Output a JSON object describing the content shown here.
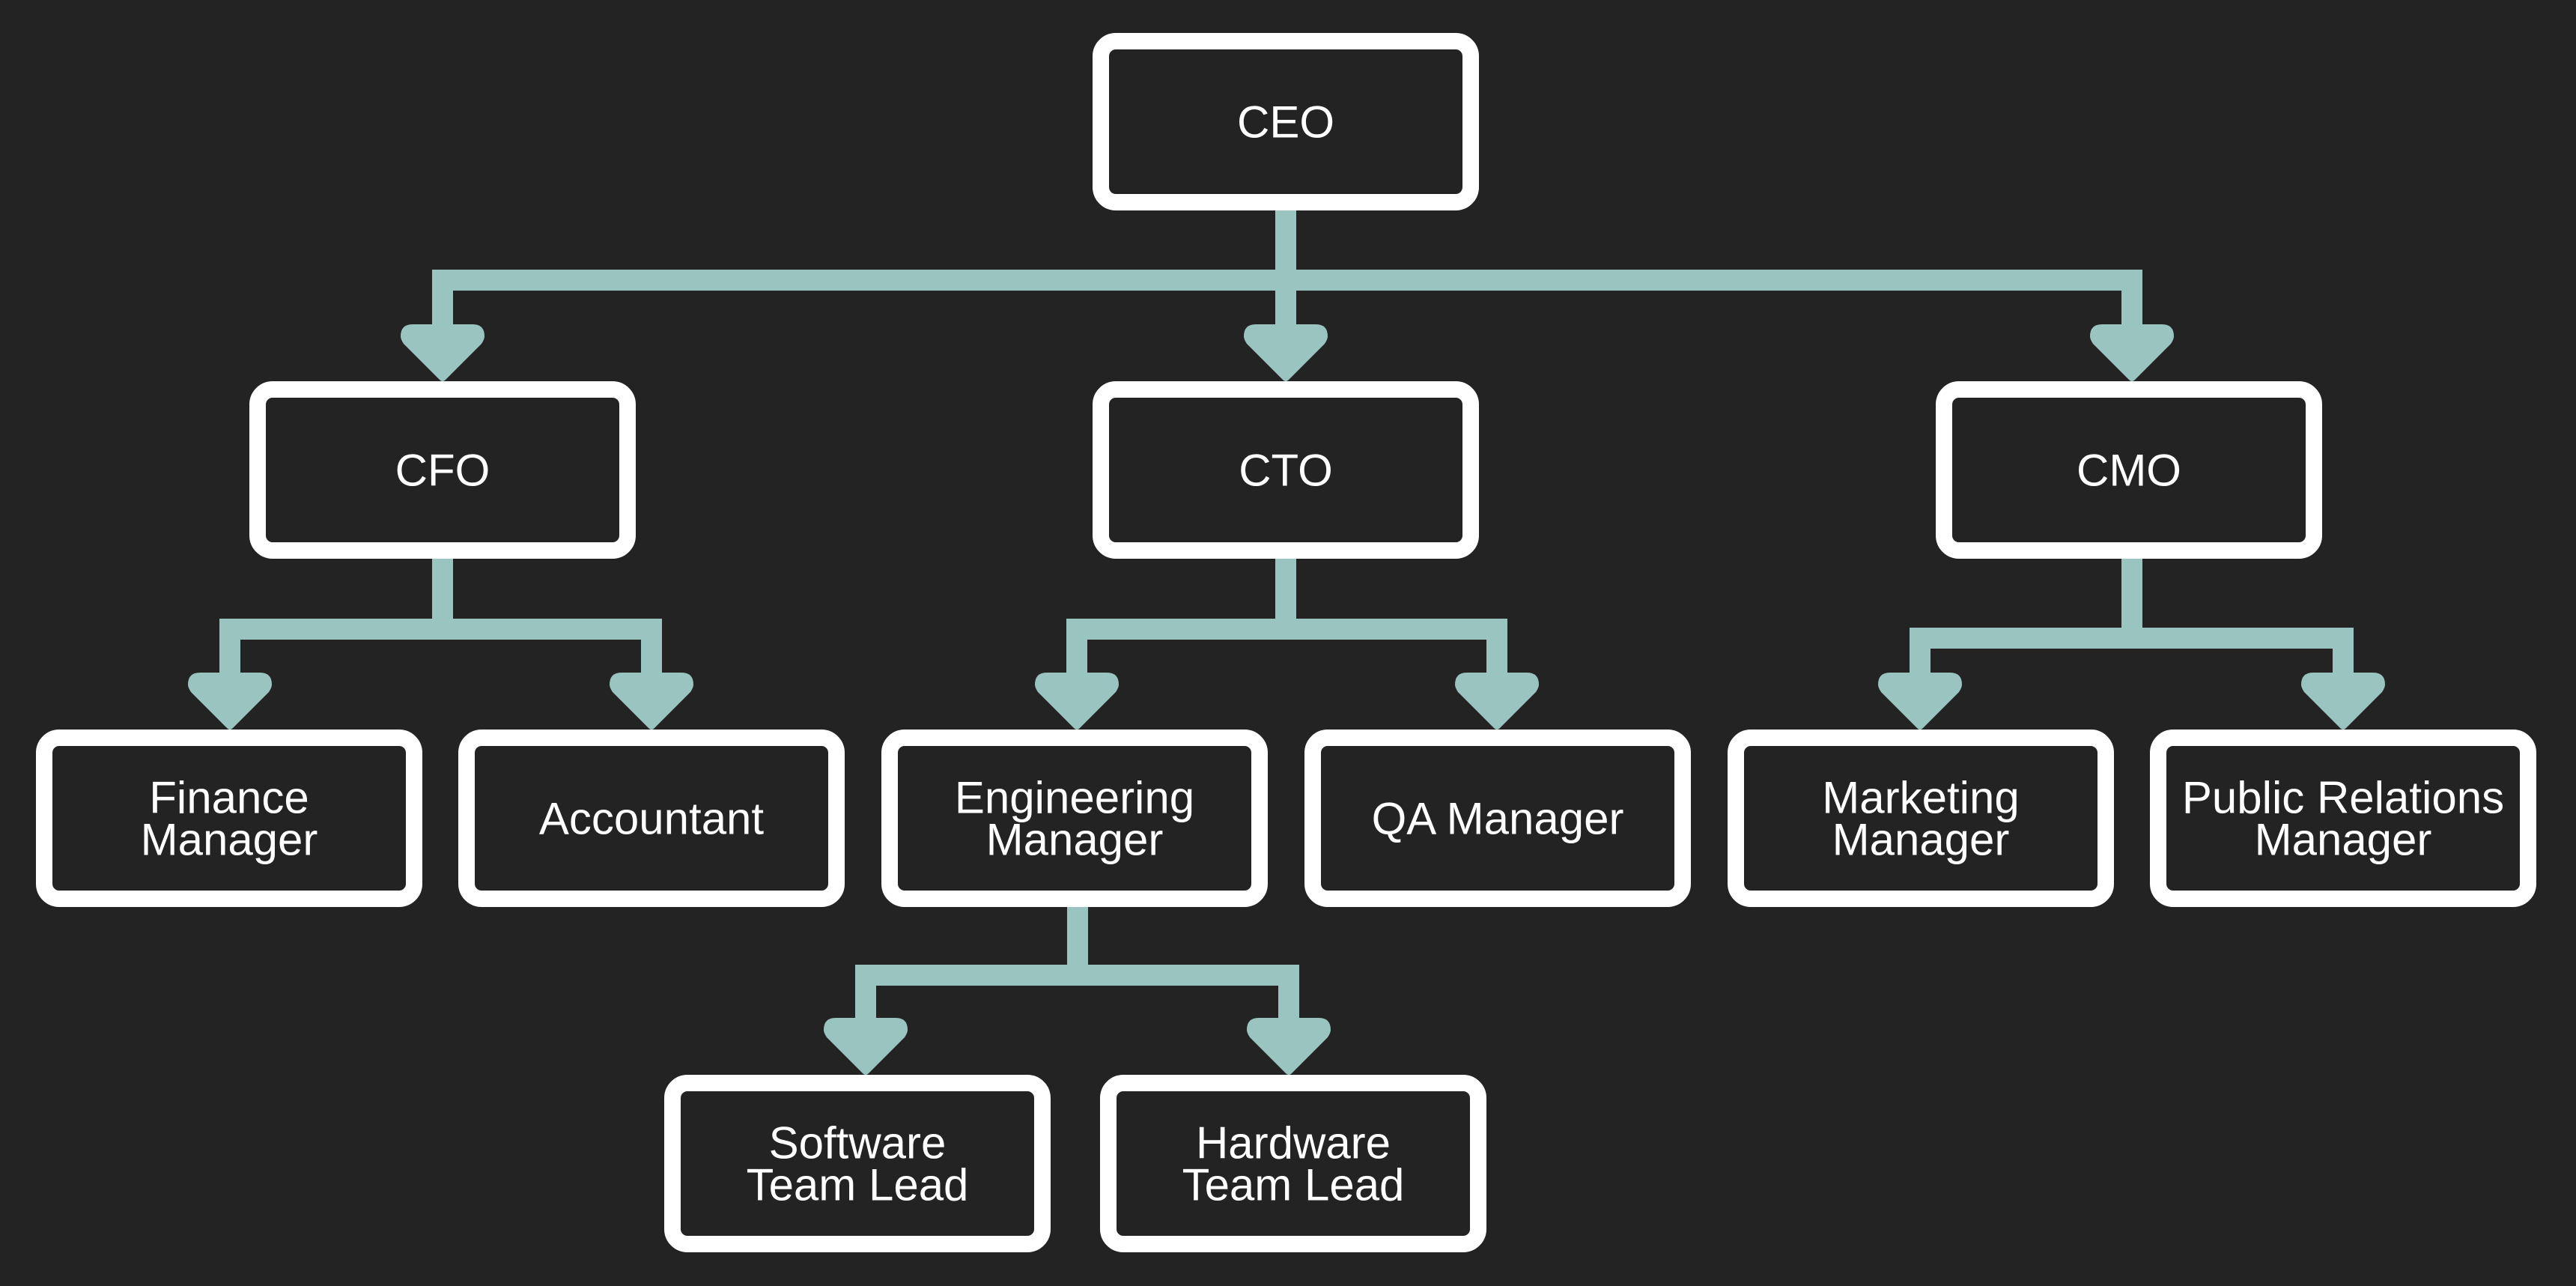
{
  "diagram": {
    "type": "org-chart",
    "colors": {
      "background": "#232323",
      "connector": "#99c4bf",
      "box_border": "#ffffff",
      "box_fill": "#232323",
      "text": "#ffffff"
    },
    "nodes": [
      {
        "id": "ceo",
        "label_lines": [
          "CEO"
        ],
        "parent": null
      },
      {
        "id": "cfo",
        "label_lines": [
          "CFO"
        ],
        "parent": "ceo"
      },
      {
        "id": "cto",
        "label_lines": [
          "CTO"
        ],
        "parent": "ceo"
      },
      {
        "id": "cmo",
        "label_lines": [
          "CMO"
        ],
        "parent": "ceo"
      },
      {
        "id": "finance-manager",
        "label_lines": [
          "Finance",
          "Manager"
        ],
        "parent": "cfo"
      },
      {
        "id": "accountant",
        "label_lines": [
          "Accountant"
        ],
        "parent": "cfo"
      },
      {
        "id": "engineering-manager",
        "label_lines": [
          "Engineering",
          "Manager"
        ],
        "parent": "cto"
      },
      {
        "id": "qa-manager",
        "label_lines": [
          "QA Manager"
        ],
        "parent": "cto"
      },
      {
        "id": "marketing-manager",
        "label_lines": [
          "Marketing",
          "Manager"
        ],
        "parent": "cmo"
      },
      {
        "id": "public-relations-manager",
        "label_lines": [
          "Public Relations",
          "Manager"
        ],
        "parent": "cmo"
      },
      {
        "id": "software-team-lead",
        "label_lines": [
          "Software",
          "Team Lead"
        ],
        "parent": "engineering-manager"
      },
      {
        "id": "hardware-team-lead",
        "label_lines": [
          "Hardware",
          "Team Lead"
        ],
        "parent": "engineering-manager"
      }
    ]
  }
}
